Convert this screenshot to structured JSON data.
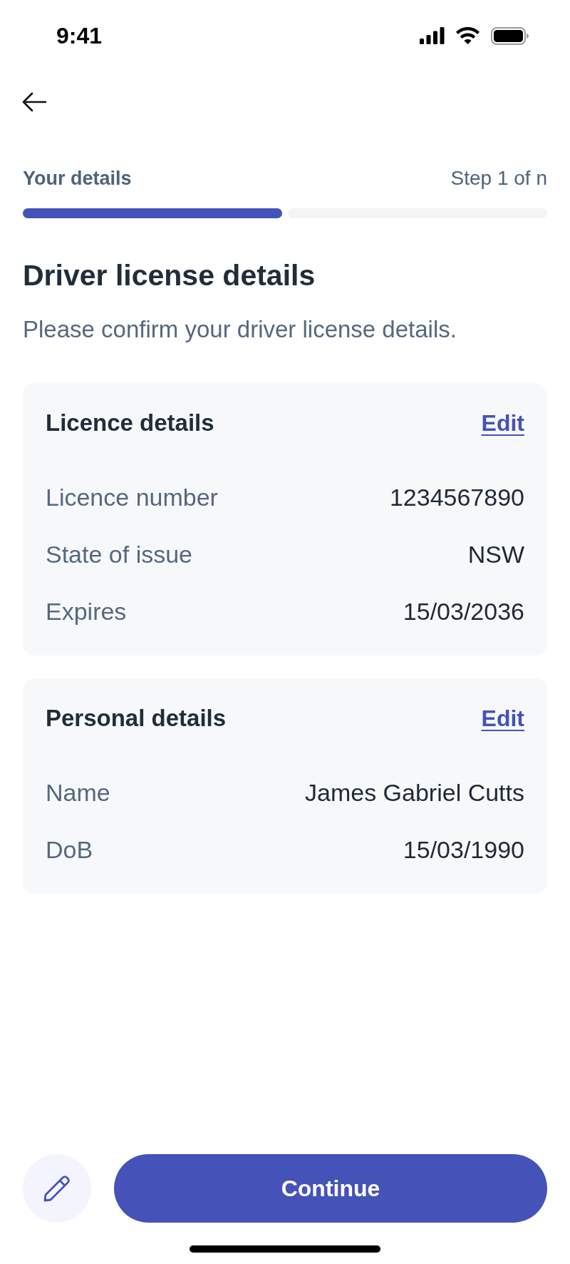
{
  "status_bar": {
    "time": "9:41"
  },
  "progress": {
    "label": "Your details",
    "step": "Step 1 of n",
    "segments": [
      {
        "complete": true
      },
      {
        "complete": false
      }
    ]
  },
  "title": "Driver license details",
  "subtitle": "Please confirm your driver license details.",
  "cards": [
    {
      "title": "Licence details",
      "action": "Edit",
      "rows": [
        {
          "label": "Licence number",
          "value": "1234567890"
        },
        {
          "label": "State of issue",
          "value": "NSW"
        },
        {
          "label": "Expires",
          "value": "15/03/2036"
        }
      ]
    },
    {
      "title": "Personal details",
      "action": "Edit",
      "rows": [
        {
          "label": "Name",
          "value": "James Gabriel Cutts"
        },
        {
          "label": "DoB",
          "value": "15/03/1990"
        }
      ]
    }
  ],
  "footer": {
    "button": "Continue"
  }
}
